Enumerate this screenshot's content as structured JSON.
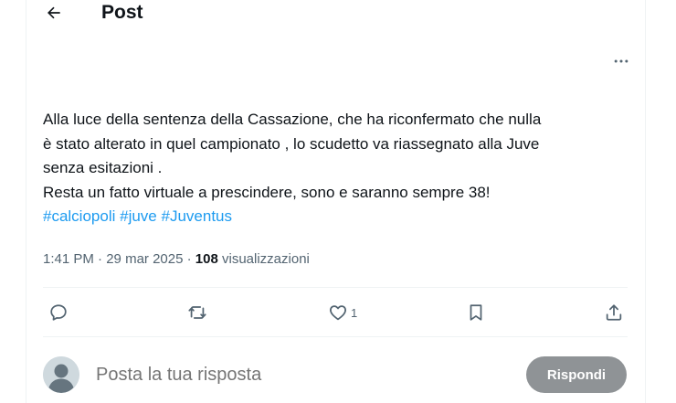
{
  "header": {
    "back_icon": "arrow-left-icon",
    "title": "Post"
  },
  "post": {
    "more_icon": "more-horizontal-icon",
    "text_lines": [
      "Alla luce della sentenza della Cassazione, che ha riconfermato che nulla",
      "è stato alterato in quel campionato , lo scudetto va riassegnato alla Juve",
      "senza esitazioni .",
      "Resta un fatto virtuale a prescindere, sono e saranno sempre 38!"
    ],
    "hashtags": [
      "#calciopoli",
      "#juve",
      "#Juventus"
    ],
    "time": "1:41 PM",
    "date": "29 mar 2025",
    "separator": "·",
    "views_count": "108",
    "views_label": "visualizzazioni"
  },
  "actions": {
    "reply_icon": "reply-icon",
    "repost_icon": "repost-icon",
    "like_icon": "heart-icon",
    "like_count": "1",
    "bookmark_icon": "bookmark-icon",
    "share_icon": "share-icon"
  },
  "reply_box": {
    "placeholder": "Posta la tua risposta",
    "button_label": "Rispondi"
  },
  "colors": {
    "text": "#0f1419",
    "secondary": "#536471",
    "link": "#1d9bf0",
    "border": "#eff3f4",
    "button_disabled": "#8f9396"
  }
}
